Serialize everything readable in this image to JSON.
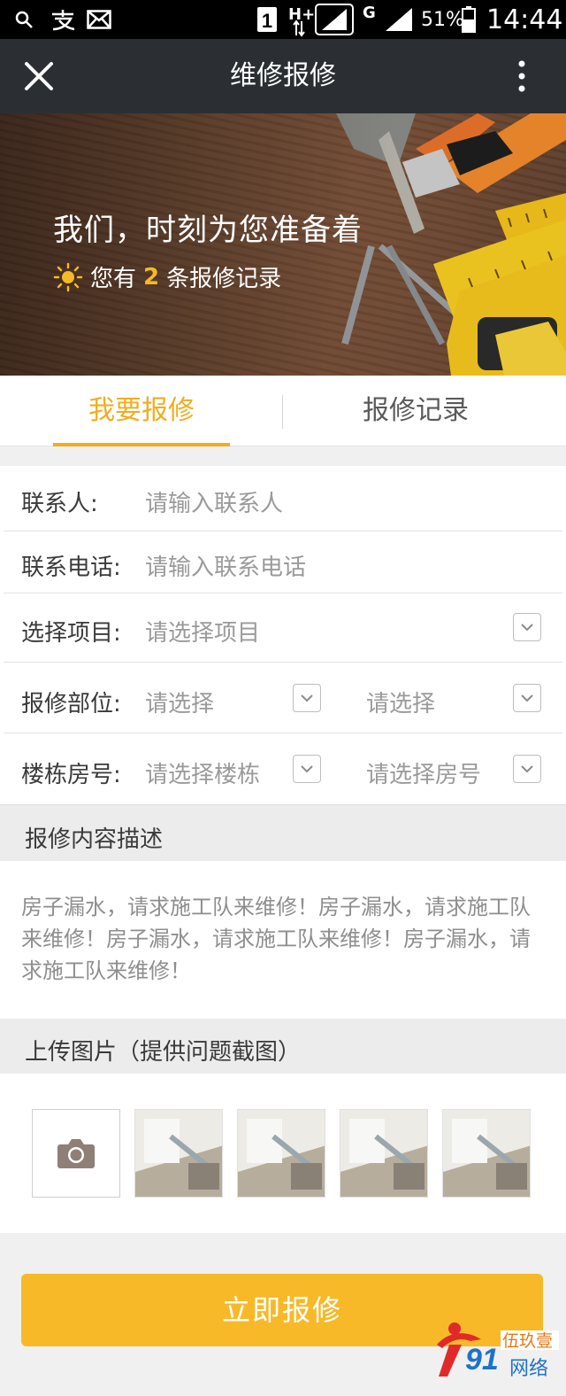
{
  "status_bar": {
    "battery_pct": "51%",
    "time": "14:44",
    "sim_indicator": "1",
    "network_label": "H+",
    "network_label_2": "G"
  },
  "app_bar": {
    "title": "维修报修"
  },
  "hero": {
    "headline": "我们，时刻为您准备着",
    "records_prefix": "您有",
    "records_count": "2",
    "records_suffix": "条报修记录"
  },
  "tabs": [
    {
      "label": "我要报修",
      "active": true
    },
    {
      "label": "报修记录",
      "active": false
    }
  ],
  "form": {
    "contact_label": "联系人:",
    "contact_placeholder": "请输入联系人",
    "phone_label": "联系电话:",
    "phone_placeholder": "请输入联系电话",
    "project_label": "选择项目:",
    "project_placeholder": "请选择项目",
    "location_label": "报修部位:",
    "location_ph_1": "请选择",
    "location_ph_2": "请选择",
    "building_label": "楼栋房号:",
    "building_ph": "请选择楼栋",
    "room_ph": "请选择房号"
  },
  "description": {
    "header": "报修内容描述",
    "text": "房子漏水，请求施工队来维修！房子漏水，请求施工队来维修！房子漏水，请求施工队来维修！房子漏水，请求施工队来维修！"
  },
  "upload": {
    "header": "上传图片（提供问题截图）"
  },
  "submit_label": "立即报修",
  "watermark": {
    "number": "91",
    "line1": "伍玖壹",
    "line2": "网络"
  },
  "colors": {
    "accent": "#f0ad1f",
    "button": "#f8b928",
    "appbar": "#2b2f33"
  }
}
